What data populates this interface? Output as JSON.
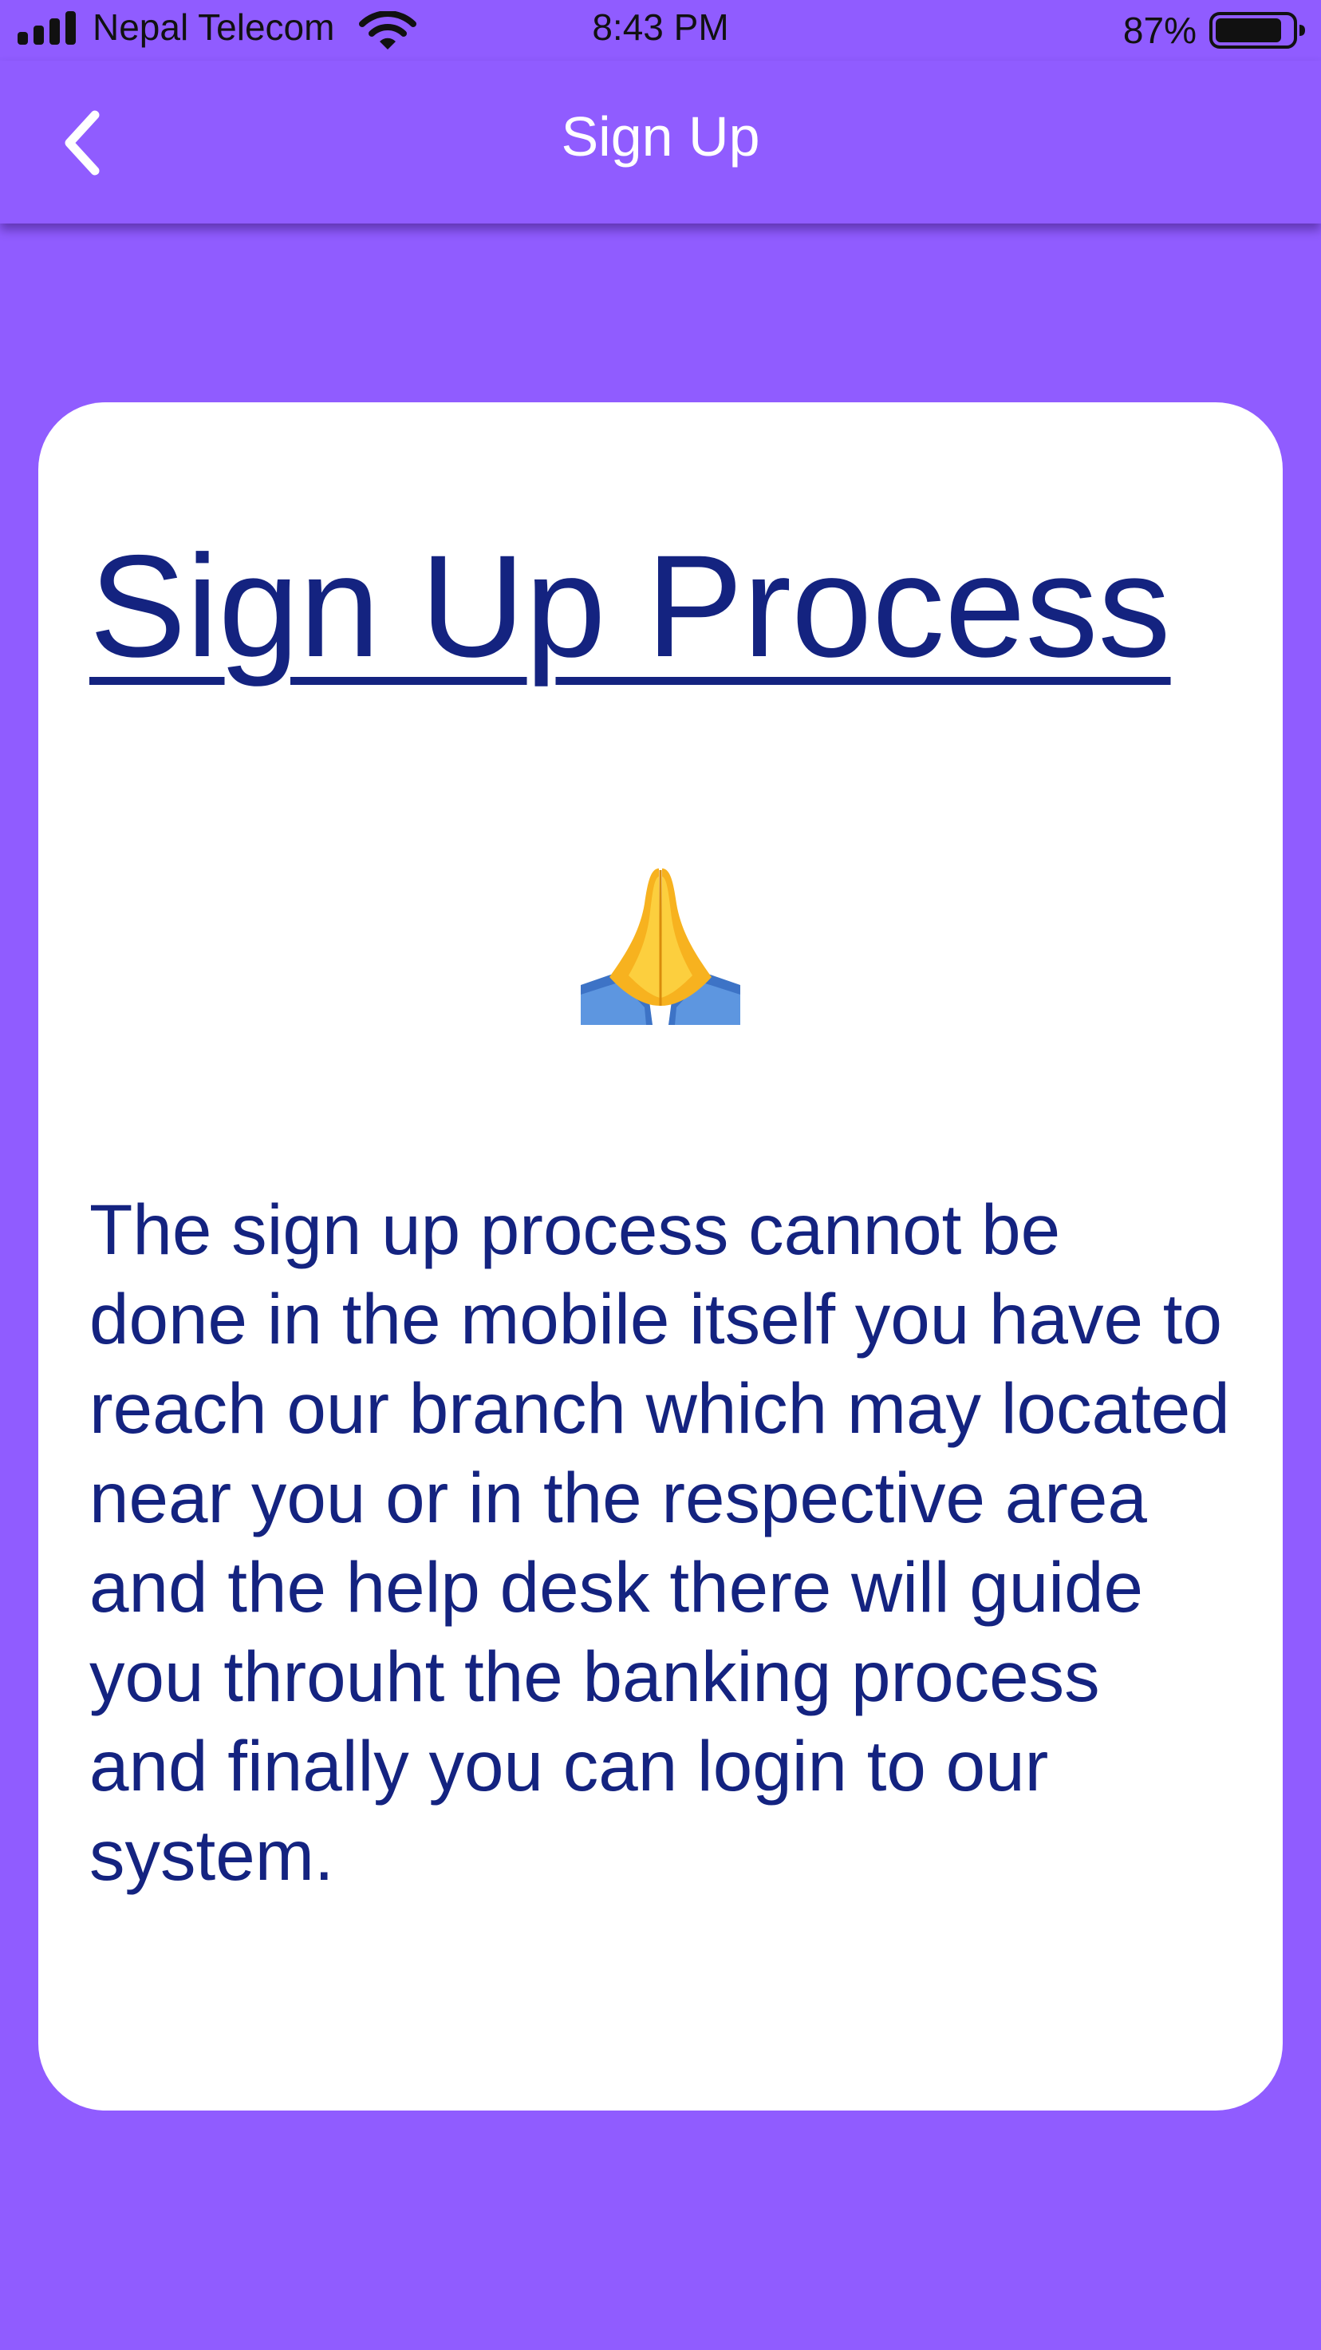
{
  "status_bar": {
    "carrier": "Nepal Telecom",
    "time": "8:43 PM",
    "battery_percent": "87%",
    "battery_level": 0.87,
    "icons": [
      "signal-icon",
      "wifi-icon",
      "battery-icon"
    ]
  },
  "nav_bar": {
    "title": "Sign Up",
    "back_icon": "chevron-left-icon"
  },
  "card": {
    "title": "Sign Up Process",
    "icon": "folded-hands-icon",
    "body": "The sign up process cannot be done in the mobile itself you have to reach our branch which may located near you or in the respective area and the help desk there will guide you throuht the banking process and finally you can login to our system."
  },
  "colors": {
    "background": "#905cff",
    "card": "#ffffff",
    "text": "#142380",
    "nav_text": "#ffffff"
  }
}
